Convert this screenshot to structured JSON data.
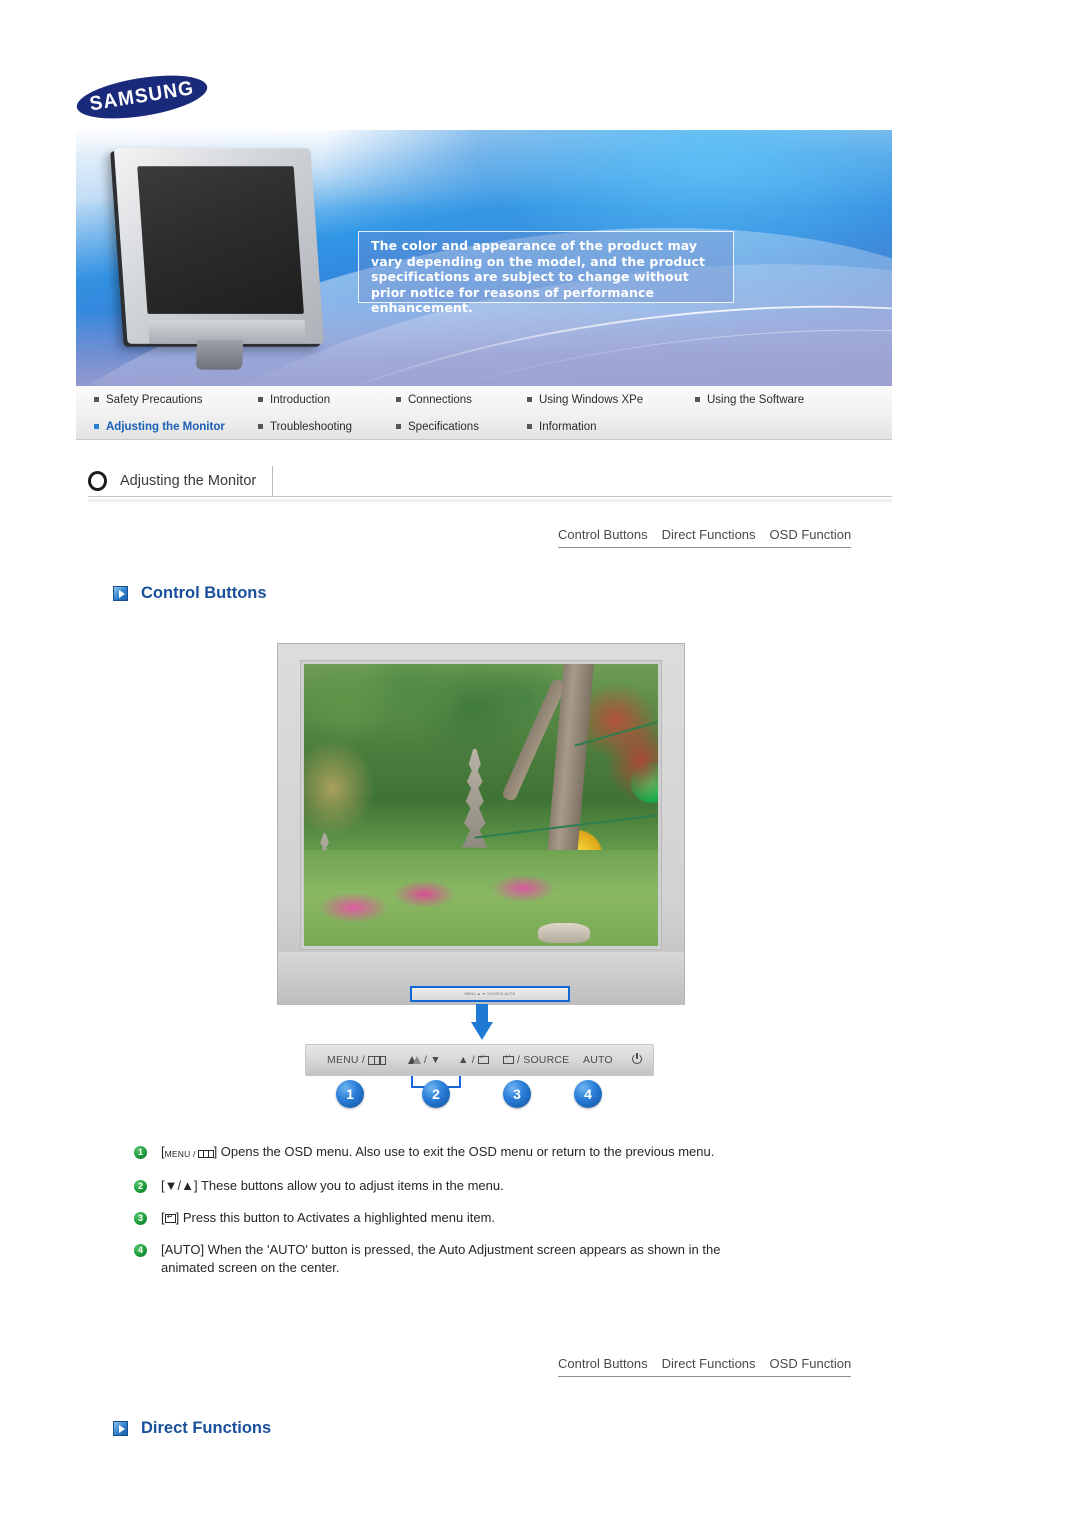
{
  "brand": {
    "logo_text": "SAMSUNG",
    "logo_name": "samsung-logo"
  },
  "hero": {
    "notice": "The color and appearance of the product may vary depending on the model, and the product specifications are subject to change without prior notice for reasons of performance enhancement."
  },
  "nav": {
    "row1": [
      {
        "label": "Safety Precautions",
        "active": false
      },
      {
        "label": "Introduction",
        "active": false
      },
      {
        "label": "Connections",
        "active": false
      },
      {
        "label": "Using Windows XPe",
        "active": false
      },
      {
        "label": "Using the Software",
        "active": false
      }
    ],
    "row2": [
      {
        "label": "Adjusting the Monitor",
        "active": true
      },
      {
        "label": "Troubleshooting",
        "active": false
      },
      {
        "label": "Specifications",
        "active": false
      },
      {
        "label": "Information",
        "active": false
      }
    ]
  },
  "page_title": "Adjusting the Monitor",
  "tab_links_top": [
    "Control Buttons",
    "Direct Functions",
    "OSD Function"
  ],
  "tab_links_bottom": [
    "Control Buttons",
    "Direct Functions",
    "OSD Function"
  ],
  "sections": {
    "control_buttons_heading": "Control Buttons",
    "direct_functions_heading": "Direct Functions"
  },
  "button_bar": {
    "menu_label": "MENU /",
    "down_label": "/ ▼",
    "up_label": "▲ /",
    "source_label": "/ SOURCE",
    "auto_label": "AUTO",
    "badges": [
      "1",
      "2",
      "3",
      "4"
    ]
  },
  "osd_strip_text": "MENU ▲ ▼ SOURCE AUTO",
  "descriptions": [
    {
      "num": "1",
      "prefix": "[",
      "icon": "menu-icon",
      "icon_text": "MENU /",
      "text": "] Opens the OSD menu. Also use to exit the OSD menu or return to the previous menu."
    },
    {
      "num": "2",
      "text": "[▼/▲] These buttons allow you to adjust items in the menu."
    },
    {
      "num": "3",
      "prefix": "[",
      "icon": "enter-icon",
      "text": "] Press this button to Activates a highlighted menu item."
    },
    {
      "num": "4",
      "text": "[AUTO] When the 'AUTO' button is pressed, the Auto Adjustment screen appears as shown in the animated screen on the center."
    }
  ],
  "colors": {
    "brand_blue": "#1a2a7a",
    "heading_blue": "#1a4f9c",
    "active_nav": "#1a5fb4",
    "badge_blue": "#2a7fd8",
    "badge_green": "#1d9c3b",
    "accent_outline": "#1168d6"
  }
}
